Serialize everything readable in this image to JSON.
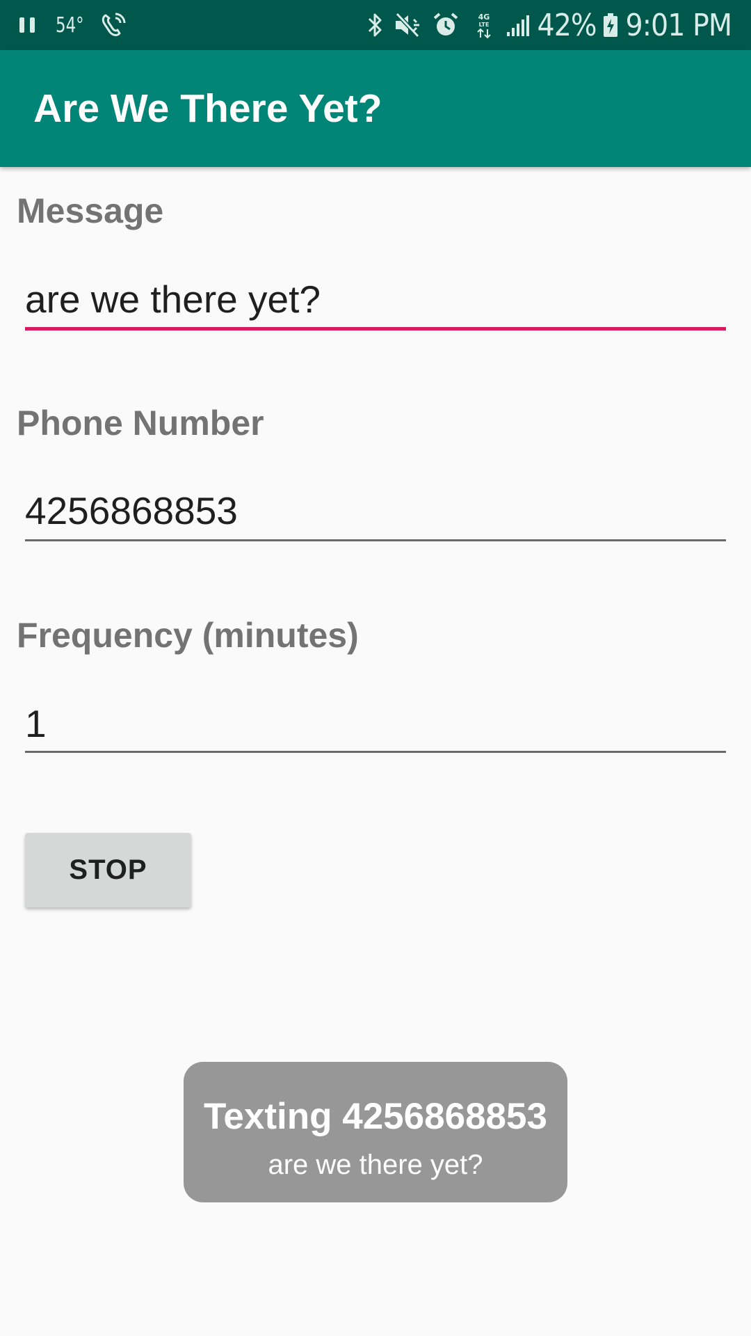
{
  "status_bar": {
    "temperature": "54°",
    "battery_percent": "42%",
    "time": "9:01 PM",
    "icons": [
      "pause-icon",
      "wifi-calling-icon",
      "bluetooth-icon",
      "mute-icon",
      "alarm-icon",
      "4g-lte-icon",
      "signal-icon",
      "battery-charging-icon"
    ]
  },
  "app_bar": {
    "title": "Are We There Yet?"
  },
  "form": {
    "message": {
      "label": "Message",
      "value": "are we there yet?"
    },
    "phone": {
      "label": "Phone Number",
      "value": "4256868853"
    },
    "frequency": {
      "label": "Frequency (minutes)",
      "value": "1"
    },
    "stop_label": "STOP"
  },
  "toast": {
    "title": "Texting 4256868853",
    "body": "are we there yet?"
  },
  "colors": {
    "status_bar": "#00574b",
    "app_bar": "#008577",
    "accent": "#d81b60",
    "toast": "#979797"
  }
}
